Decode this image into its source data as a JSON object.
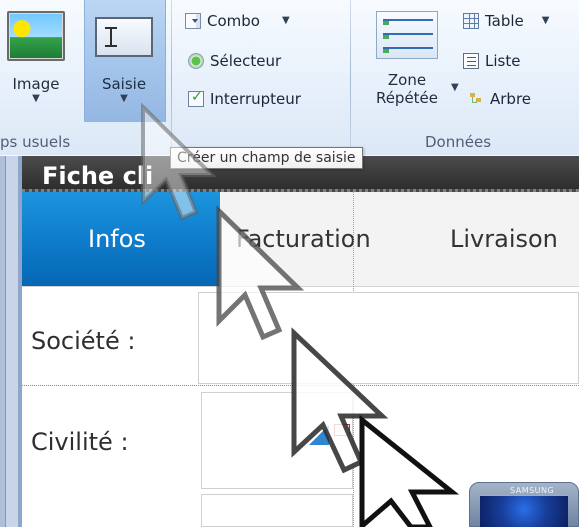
{
  "ribbon": {
    "image_label": "Image",
    "saisie_label": "Saisie",
    "group_usuels": "ps usuels",
    "combo_label": "Combo",
    "selecteur_label": "Sélecteur",
    "interrupteur_label": "Interrupteur",
    "zone_label_line1": "Zone",
    "zone_label_line2": "Répétée",
    "table_label": "Table",
    "liste_label": "Liste",
    "arbre_label": "Arbre",
    "donnees_group": "Données"
  },
  "tooltip": {
    "text": "Créer un champ de saisie"
  },
  "document": {
    "title": "Fiche cli",
    "tabs": [
      {
        "label": "Infos"
      },
      {
        "label": "Facturation"
      },
      {
        "label": "Livraison"
      }
    ],
    "fields": [
      {
        "label": "Société :"
      },
      {
        "label": "Civilité :"
      }
    ]
  },
  "device": {
    "brand": "SAMSUNG"
  },
  "colors": {
    "ribbon_bg": "#e7f0fb",
    "saisie_highlight": "#a6c6ec",
    "active_tab": "#0f7dcc",
    "title_bar": "#2e2e2e"
  }
}
